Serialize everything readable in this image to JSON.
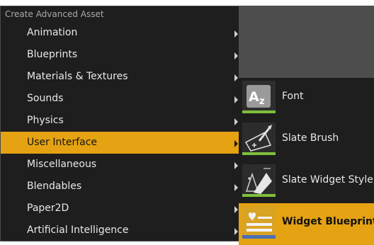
{
  "menu": {
    "header": "Create Advanced Asset",
    "items": [
      {
        "label": "Animation"
      },
      {
        "label": "Blueprints"
      },
      {
        "label": "Materials & Textures"
      },
      {
        "label": "Sounds"
      },
      {
        "label": "Physics"
      },
      {
        "label": "User Interface",
        "selected": true
      },
      {
        "label": "Miscellaneous"
      },
      {
        "label": "Blendables"
      },
      {
        "label": "Paper2D"
      },
      {
        "label": "Artificial Intelligence"
      }
    ]
  },
  "submenu": {
    "items": [
      {
        "label": "Font",
        "icon": "font-asset-icon"
      },
      {
        "label": "Slate Brush",
        "icon": "slate-brush-icon"
      },
      {
        "label": "Slate Widget Style",
        "icon": "slate-widget-style-icon"
      },
      {
        "label": "Widget Blueprint",
        "icon": "widget-blueprint-icon",
        "selected": true
      }
    ]
  },
  "colors": {
    "selected_bg": "#e5a212",
    "menu_bg": "#1e1e1e",
    "text": "#e8e8e8",
    "thumb_underline": "#7fbf3a",
    "thumb_underline_selected": "#4a6fb5"
  }
}
